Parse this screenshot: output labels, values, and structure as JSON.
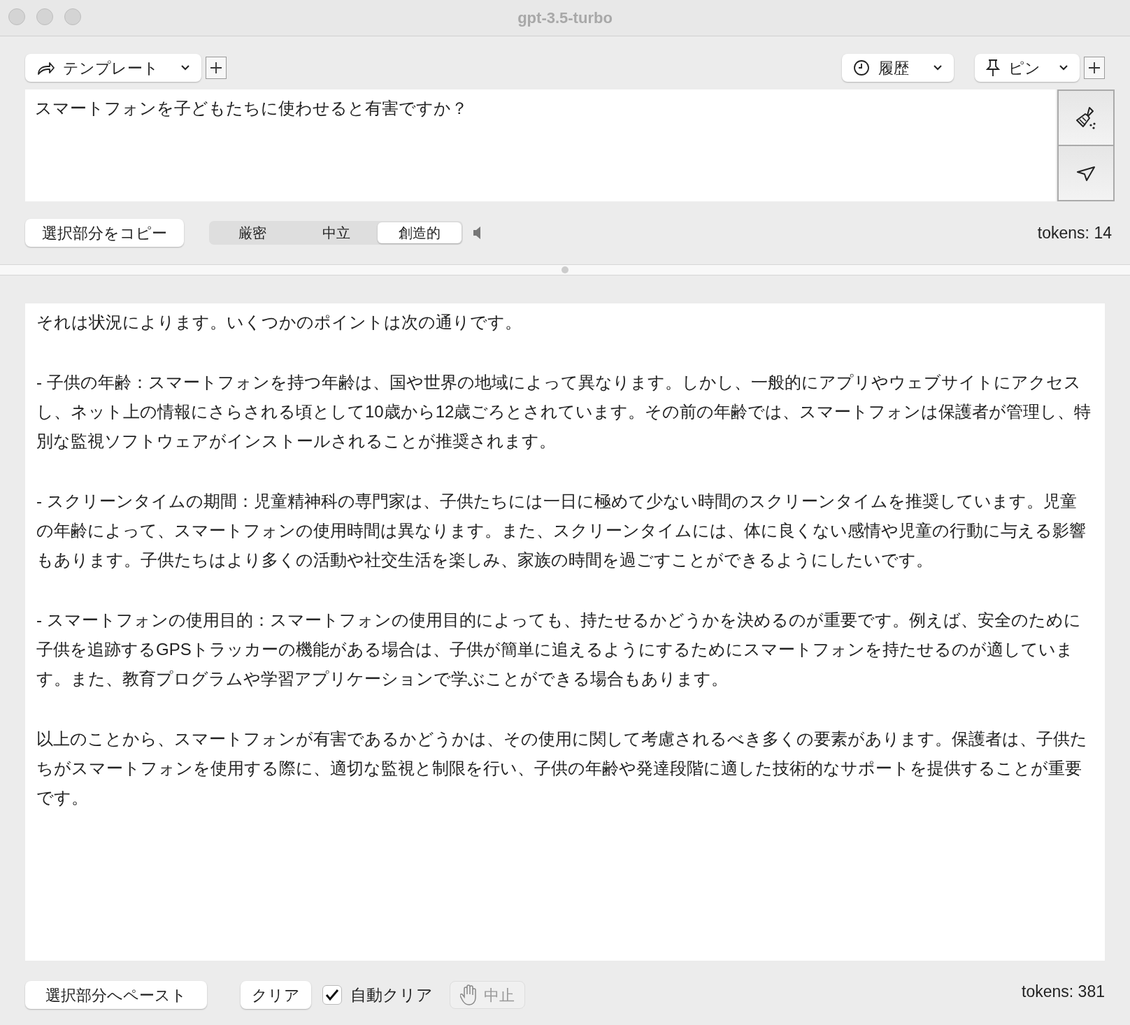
{
  "window": {
    "title": "gpt-3.5-turbo"
  },
  "toolbar": {
    "template": {
      "label": "テンプレート"
    },
    "history": {
      "label": "履歴"
    },
    "pin": {
      "label": "ピン"
    }
  },
  "prompt": {
    "value": "スマートフォンを子どもたちに使わせると有害ですか？"
  },
  "copy_button": "選択部分をコピー",
  "temperature": [
    {
      "label": "厳密",
      "selected": false
    },
    {
      "label": "中立",
      "selected": false
    },
    {
      "label": "創造的",
      "selected": true
    }
  ],
  "prompt_tokens": "tokens: 14",
  "response": [
    "それは状況によります。いくつかのポイントは次の通りです。",
    "- 子供の年齢：スマートフォンを持つ年齢は、国や世界の地域によって異なります。しかし、一般的にアプリやウェブサイトにアクセスし、ネット上の情報にさらされる頃として10歳から12歳ごろとされています。その前の年齢では、スマートフォンは保護者が管理し、特別な監視ソフトウェアがインストールされることが推奨されます。",
    "- スクリーンタイムの期間：児童精神科の専門家は、子供たちには一日に極めて少ない時間のスクリーンタイムを推奨しています。児童の年齢によって、スマートフォンの使用時間は異なります。また、スクリーンタイムには、体に良くない感情や児童の行動に与える影響もあります。子供たちはより多くの活動や社交生活を楽しみ、家族の時間を過ごすことができるようにしたいです。",
    "- スマートフォンの使用目的：スマートフォンの使用目的によっても、持たせるかどうかを決めるのが重要です。例えば、安全のために子供を追跡するGPSトラッカーの機能がある場合は、子供が簡単に追えるようにするためにスマートフォンを持たせるのが適しています。また、教育プログラムや学習アプリケーションで学ぶことができる場合もあります。",
    "以上のことから、スマートフォンが有害であるかどうかは、その使用に関して考慮されるべき多くの要素があります。保護者は、子供たちがスマートフォンを使用する際に、適切な監視と制限を行い、子供の年齢や発達段階に適した技術的なサポートを提供することが重要です。"
  ],
  "bottom": {
    "paste_button": "選択部分へペースト",
    "clear_button": "クリア",
    "auto_clear": {
      "label": "自動クリア",
      "checked": true
    },
    "stop_button": {
      "label": "中止",
      "disabled": true
    }
  },
  "response_tokens": "tokens: 381"
}
